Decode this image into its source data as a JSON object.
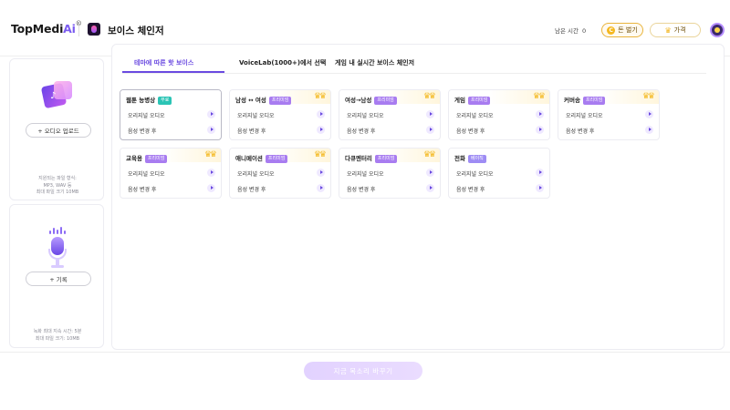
{
  "header": {
    "logo_main": "TopMedi",
    "logo_ai": "Ai",
    "logo_reg": "®",
    "app_title": "보이스 체인저",
    "remaining_label": "남은 시간",
    "remaining_value": "0",
    "coins_label": "돈 벌기",
    "price_label": "가격"
  },
  "left": {
    "upload_button": "+ 오디오 업로드",
    "upload_hint": [
      "지원되는 파일 형식:",
      "MP3, WAV 등",
      "최대 파일 크기 10MB"
    ],
    "record_button": "+ 기록",
    "record_hint": [
      "녹화 최대 지속 시간: 5분",
      "최대 파일 크기: 10MB"
    ]
  },
  "tabs": [
    {
      "label": "테마에 따른 핫 보이스",
      "active": true
    },
    {
      "label": "VoiceLab(1000+)에서 선택",
      "active": false
    },
    {
      "label": "게임 내 실시간 보이스 체인저",
      "active": false
    }
  ],
  "cards": [
    {
      "title": "웹툰 능병상",
      "badge": "무료",
      "badge_type": "free",
      "crown": false,
      "rows": [
        "오리지널 오디오",
        "음성 변경 후"
      ]
    },
    {
      "title": "남성 ↔ 여성",
      "badge": "프리미엄",
      "badge_type": "premium",
      "crown": true,
      "rows": [
        "오리지널 오디오",
        "음성 변경 후"
      ]
    },
    {
      "title": "여성→남성",
      "badge": "프리미엄",
      "badge_type": "premium",
      "crown": true,
      "rows": [
        "오리지널 오디오",
        "음성 변경 후"
      ]
    },
    {
      "title": "게임",
      "badge": "프리미엄",
      "badge_type": "premium",
      "crown": true,
      "rows": [
        "오리지널 오디오",
        "음성 변경 후"
      ]
    },
    {
      "title": "커버송",
      "badge": "프리미엄",
      "badge_type": "premium",
      "crown": true,
      "rows": [
        "오리지널 오디오",
        "음성 변경 후"
      ]
    },
    {
      "title": "교육용",
      "badge": "프리미엄",
      "badge_type": "premium",
      "crown": true,
      "rows": [
        "오리지널 오디오",
        "음성 변경 후"
      ]
    },
    {
      "title": "애니메이션",
      "badge": "프리미엄",
      "badge_type": "premium",
      "crown": true,
      "rows": [
        "오리지널 오디오",
        "음성 변경 후"
      ]
    },
    {
      "title": "다큐멘터리",
      "badge": "프리미엄",
      "badge_type": "premium",
      "crown": true,
      "rows": [
        "오리지널 오디오",
        "음성 변경 후"
      ]
    },
    {
      "title": "전화",
      "badge": "베이직",
      "badge_type": "basic",
      "crown": false,
      "rows": [
        "오리지널 오디오",
        "음성 변경 후"
      ]
    }
  ],
  "crown_label": "VIP",
  "convert_button": "지금 목소리 바꾸기",
  "colors": {
    "accent": "#6a4ae0",
    "crown": "#f4b81f",
    "free_badge": "#2bc4b5",
    "premium_badge": "#a87cf0"
  }
}
